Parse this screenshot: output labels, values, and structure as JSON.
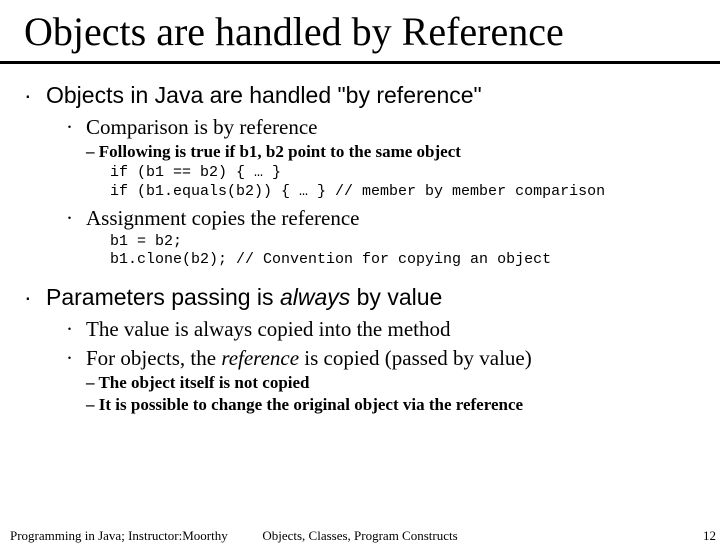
{
  "title": "Objects are handled by Reference",
  "p1": {
    "text": "Objects in Java are handled \"by reference\"",
    "s1": {
      "text": "Comparison is by reference",
      "note": "– Following is true if b1, b2 point to the same object",
      "code1": "if (b1 == b2) { … }",
      "code2": "if (b1.equals(b2)) { … } // member by member comparison"
    },
    "s2": {
      "text": "Assignment copies the reference",
      "code1": "b1 = b2;",
      "code2": "b1.clone(b2); // Convention for copying an object"
    }
  },
  "p2": {
    "prefix": "Parameters passing is ",
    "italic": "always",
    "suffix": " by value",
    "s1": {
      "text": "The value is always copied into the method"
    },
    "s2": {
      "prefix": "For objects, the ",
      "italic": "reference",
      "suffix": " is copied (passed by value)",
      "note1": "– The object itself is not copied",
      "note2": "– It is possible to change the original object via the reference"
    }
  },
  "footer": {
    "left": "Programming in Java; Instructor:Moorthy",
    "center": "Objects, Classes, Program Constructs",
    "right": "12"
  }
}
